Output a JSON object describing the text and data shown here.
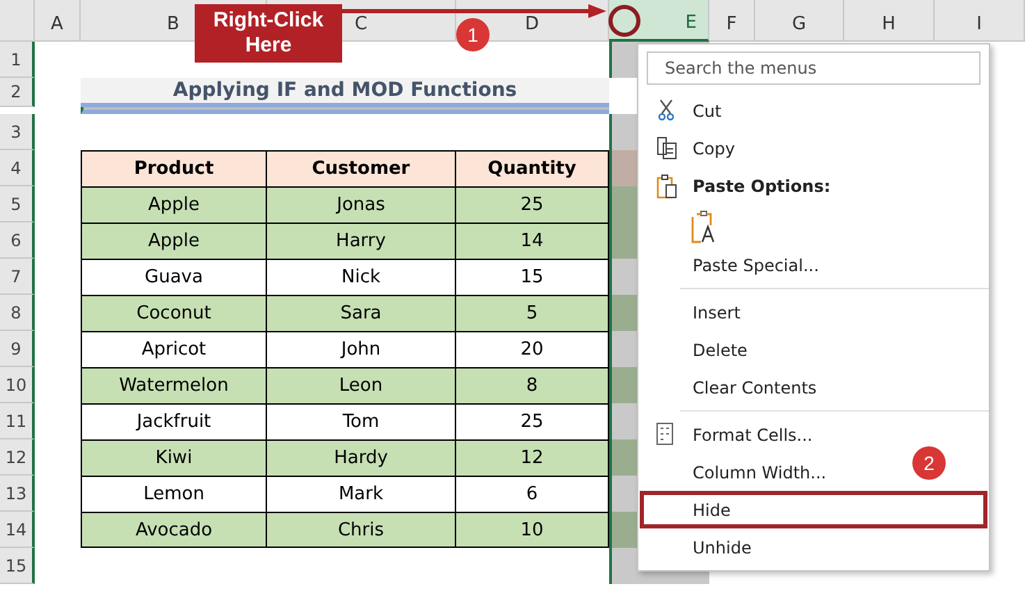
{
  "columns": [
    {
      "label": "A",
      "selected": false
    },
    {
      "label": "B",
      "selected": false
    },
    {
      "label": "C",
      "selected": false
    },
    {
      "label": "D",
      "selected": false
    },
    {
      "label": "E",
      "selected": true
    },
    {
      "label": "F",
      "selected": false
    },
    {
      "label": "G",
      "selected": false
    },
    {
      "label": "H",
      "selected": false
    },
    {
      "label": "I",
      "selected": false
    }
  ],
  "row_numbers": [
    "1",
    "2",
    "3",
    "4",
    "5",
    "6",
    "7",
    "8",
    "9",
    "10",
    "11",
    "12",
    "13",
    "14",
    "15"
  ],
  "title": "Applying IF and MOD Functions",
  "table": {
    "columns": [
      "Product",
      "Customer",
      "Quantity"
    ],
    "rows": [
      {
        "cells": [
          "Apple",
          "Jonas",
          "25"
        ],
        "shaded": true
      },
      {
        "cells": [
          "Apple",
          "Harry",
          "14"
        ],
        "shaded": true
      },
      {
        "cells": [
          "Guava",
          "Nick",
          "15"
        ],
        "shaded": false
      },
      {
        "cells": [
          "Coconut",
          "Sara",
          "5"
        ],
        "shaded": true
      },
      {
        "cells": [
          "Apricot",
          "John",
          "20"
        ],
        "shaded": false
      },
      {
        "cells": [
          "Watermelon",
          "Leon",
          "8"
        ],
        "shaded": true
      },
      {
        "cells": [
          "Jackfruit",
          "Tom",
          "25"
        ],
        "shaded": false
      },
      {
        "cells": [
          "Kiwi",
          "Hardy",
          "12"
        ],
        "shaded": true
      },
      {
        "cells": [
          "Lemon",
          "Mark",
          "6"
        ],
        "shaded": false
      },
      {
        "cells": [
          "Avocado",
          "Chris",
          "10"
        ],
        "shaded": true
      }
    ]
  },
  "context_menu": {
    "search": {
      "placeholder": "Search the menus"
    },
    "items": [
      {
        "kind": "cut",
        "label": "Cut",
        "highlighted": false
      },
      {
        "kind": "copy",
        "label": "Copy",
        "highlighted": false
      },
      {
        "kind": "heading",
        "label": "Paste Options:"
      },
      {
        "kind": "paste"
      },
      {
        "kind": "command",
        "label": "Paste Special...",
        "highlighted": false
      },
      {
        "kind": "separator"
      },
      {
        "kind": "command",
        "label": "Insert",
        "highlighted": false
      },
      {
        "kind": "command",
        "label": "Delete",
        "highlighted": false
      },
      {
        "kind": "command",
        "label": "Clear Contents",
        "highlighted": false
      },
      {
        "kind": "separator"
      },
      {
        "kind": "format",
        "label": "Format Cells...",
        "highlighted": false
      },
      {
        "kind": "command",
        "label": "Column Width...",
        "highlighted": false
      },
      {
        "kind": "command",
        "label": "Hide",
        "highlighted": true
      },
      {
        "kind": "command",
        "label": "Unhide",
        "highlighted": false
      }
    ]
  },
  "annotations": {
    "callout": "Right-Click Here",
    "steps": [
      "1",
      "2"
    ]
  }
}
